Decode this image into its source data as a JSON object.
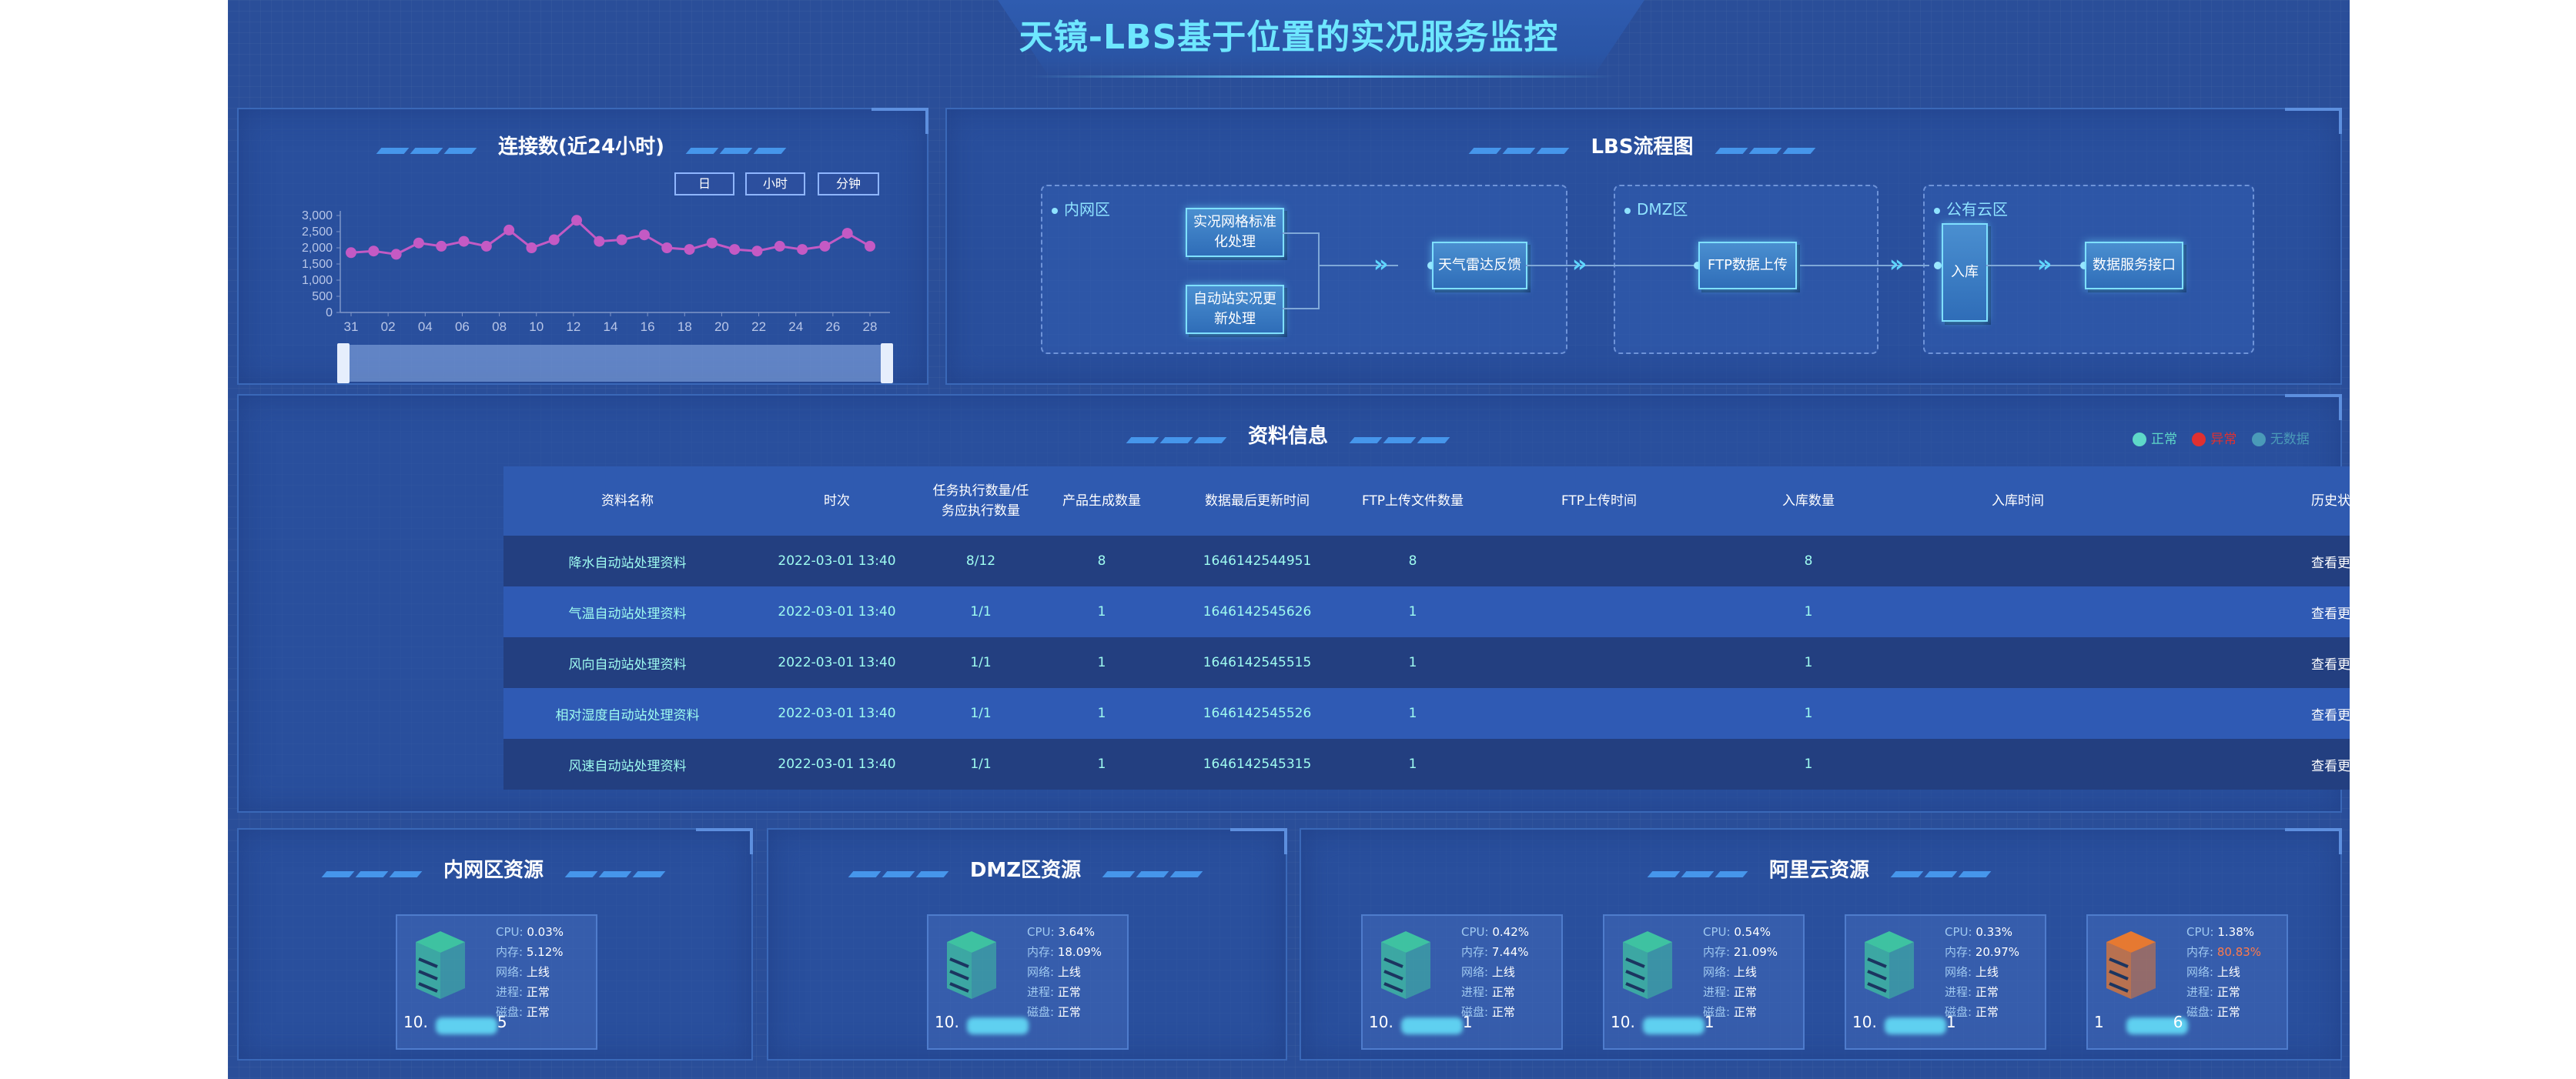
{
  "header": {
    "title": "天镜-LBS基于位置的实况服务监控"
  },
  "connections": {
    "title": "连接数(近24小时)",
    "buttons": [
      "日",
      "小时",
      "分钟"
    ]
  },
  "chart_data": {
    "type": "line",
    "title": "",
    "x": [
      "31",
      "02",
      "04",
      "06",
      "08",
      "10",
      "12",
      "14",
      "16",
      "18",
      "20",
      "22",
      "24",
      "26",
      "28"
    ],
    "series": [
      {
        "values": [
          1850,
          1900,
          1800,
          2150,
          2050,
          2200,
          2050,
          2550,
          2000,
          2250,
          2850,
          2200,
          2250,
          2400,
          2000,
          1950,
          2150,
          1950,
          1900,
          2050,
          1950,
          2050,
          2450,
          2050
        ]
      }
    ],
    "y_ticks": [
      "0",
      "500",
      "1,000",
      "1,500",
      "2,000",
      "2,500",
      "3,000"
    ],
    "ylim": [
      0,
      3000
    ],
    "color": "#c45ac4"
  },
  "flow": {
    "title": "LBS流程图",
    "zones": [
      "内网区",
      "DMZ区",
      "公有云区"
    ],
    "nodes": {
      "n1": "实况网格标准化处理",
      "n2": "自动站实况更新处理",
      "n3": "天气雷达反馈",
      "n4": "FTP数据上传",
      "n5": "入库",
      "n6": "数据服务接口"
    }
  },
  "materials": {
    "title": "资料信息",
    "legend": [
      "正常",
      "异常",
      "无数据"
    ],
    "legend_colors": [
      "#5ed8c8",
      "#e03030",
      "#4a9ab8"
    ],
    "columns": [
      "资料名称",
      "时次",
      "任务执行数量/任务应执行数量",
      "产品生成数量",
      "数据最后更新时间",
      "FTP上传文件数量",
      "FTP上传时间",
      "入库数量",
      "入库时间",
      "历史状态"
    ],
    "rows": [
      [
        "降水自动站处理资料",
        "2022-03-01 13:40",
        "8/12",
        "8",
        "1646142544951",
        "8",
        "",
        "8",
        "",
        "查看更多"
      ],
      [
        "气温自动站处理资料",
        "2022-03-01 13:40",
        "1/1",
        "1",
        "1646142545626",
        "1",
        "",
        "1",
        "",
        "查看更多"
      ],
      [
        "风向自动站处理资料",
        "2022-03-01 13:40",
        "1/1",
        "1",
        "1646142545515",
        "1",
        "",
        "1",
        "",
        "查看更多"
      ],
      [
        "相对湿度自动站处理资料",
        "2022-03-01 13:40",
        "1/1",
        "1",
        "1646142545526",
        "1",
        "",
        "1",
        "",
        "查看更多"
      ],
      [
        "风速自动站处理资料",
        "2022-03-01 13:40",
        "1/1",
        "1",
        "1646142545315",
        "1",
        "",
        "1",
        "",
        "查看更多"
      ]
    ]
  },
  "resources": {
    "intranet": {
      "title": "内网区资源"
    },
    "dmz": {
      "title": "DMZ区资源"
    },
    "aliyun": {
      "title": "阿里云资源"
    },
    "labels": {
      "cpu": "CPU:",
      "mem": "内存:",
      "net": "网络:",
      "proc": "进程:",
      "disk": "磁盘:"
    },
    "servers": [
      {
        "ip_prefix": "10.",
        "ip_suffix": "5",
        "cpu": "0.03%",
        "mem": "5.12%",
        "net": "上线",
        "proc": "正常",
        "disk": "正常",
        "status_color": "#3fc7a0"
      },
      {
        "ip_prefix": "10.",
        "ip_suffix": "",
        "cpu": "3.64%",
        "mem": "18.09%",
        "net": "上线",
        "proc": "正常",
        "disk": "正常",
        "status_color": "#3fc7a0"
      },
      {
        "ip_prefix": "10.",
        "ip_suffix": "1",
        "cpu": "0.42%",
        "mem": "7.44%",
        "net": "上线",
        "proc": "正常",
        "disk": "正常",
        "status_color": "#3fc7a0"
      },
      {
        "ip_prefix": "10.",
        "ip_suffix": "1",
        "cpu": "0.54%",
        "mem": "21.09%",
        "net": "上线",
        "proc": "正常",
        "disk": "正常",
        "status_color": "#3fc7a0"
      },
      {
        "ip_prefix": "10.",
        "ip_suffix": "1",
        "cpu": "0.33%",
        "mem": "20.97%",
        "net": "上线",
        "proc": "正常",
        "disk": "正常",
        "status_color": "#3fc7a0"
      },
      {
        "ip_prefix": "1",
        "ip_suffix": "6",
        "cpu": "1.38%",
        "mem": "80.83%",
        "net": "上线",
        "proc": "正常",
        "disk": "正常",
        "status_color": "#f07a2a",
        "mem_warn": true
      }
    ]
  }
}
